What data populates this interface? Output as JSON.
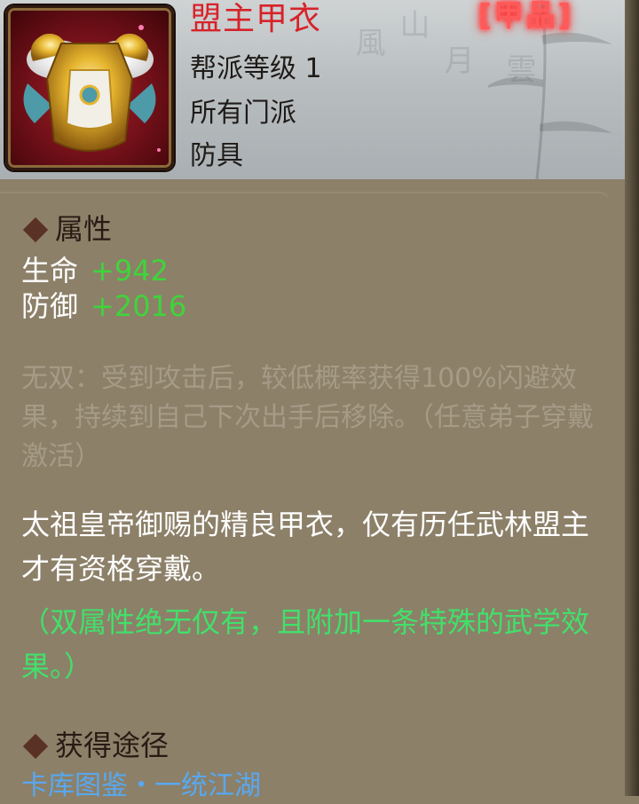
{
  "item": {
    "name": "盟主甲衣",
    "rarity": "[甲品]",
    "guild_level": "帮派等级 1",
    "sect": "所有门派",
    "category": "防具",
    "icon": "golden-armor-icon"
  },
  "attributes": {
    "title": "属性",
    "stats": [
      {
        "label": "生命",
        "value": "+942"
      },
      {
        "label": "防御",
        "value": "+2016"
      }
    ]
  },
  "passive_text": "无双：受到攻击后，较低概率获得100%闪避效果，持续到自己下次出手后移除。（任意弟子穿戴激活）",
  "description": "太祖皇帝御赐的精良甲衣，仅有历任武林盟主才有资格穿戴。",
  "note": "（双属性绝无仅有，且附加一条特殊的武学效果。）",
  "acquire": {
    "title": "获得途径",
    "source": "卡库图鉴・一统江湖"
  },
  "colors": {
    "name_red": "#d6232a",
    "stat_green": "#3fd43a",
    "note_green": "#42e06a",
    "passive_gray": "#a59b86",
    "link_blue": "#58a8f0",
    "panel_bg": "#8c8069"
  }
}
